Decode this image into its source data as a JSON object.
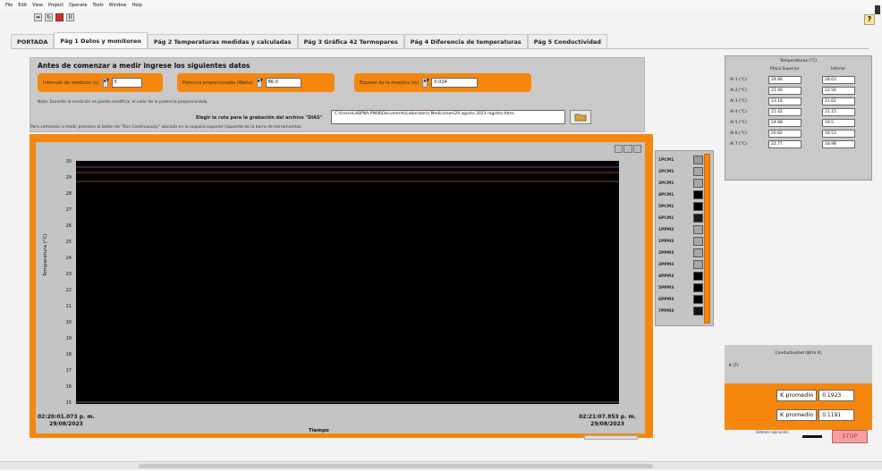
{
  "menu": [
    "File",
    "Edit",
    "View",
    "Project",
    "Operate",
    "Tools",
    "Window",
    "Help"
  ],
  "toolbar": {
    "run_glyph": "➡",
    "cont_glyph": "↻",
    "stop_glyph": "■",
    "pause_glyph": "II"
  },
  "help_glyph": "?",
  "tabs": [
    {
      "label": "PORTADA",
      "active": false
    },
    {
      "label": "Pág 1 Datos y monitoreo",
      "active": true
    },
    {
      "label": "Pág 2 Temperaturas medidas y calculadas",
      "active": false
    },
    {
      "label": "Pág 3 Gráfica 42 Termopares",
      "active": false
    },
    {
      "label": "Pág 4 Diferencia de temperaturas",
      "active": false
    },
    {
      "label": "Pág 5 Conductividad",
      "active": false
    }
  ],
  "setup": {
    "title": "Antes de comenzar a medir ingrese los siguientes datos",
    "field1": {
      "label": "Intervalo de medición (s)",
      "value": "5"
    },
    "field2": {
      "label": "Potencia proporcionada (Watts)",
      "value": "86.0"
    },
    "field3": {
      "label": "Espesor de la muestra (m)",
      "value": "0.024"
    },
    "note": "Nota: Durante la medición se puede modificar el valor de la potencia proporcionada.",
    "path_label": "Elegir la ruta para la grabación del archivo \"DIAS\"",
    "path_value": "C:\\Users\\LABPNA-PN08\\Documents\\Laboratorio Mediciones\\29 agosto 2023 registro.tdms",
    "instructions": "Para comenzar a medir presione el botón de \"Run Continuously\" ubicado en la esquina superior izquierda de la barra de herramientas."
  },
  "graph": {
    "y_title": "Temperatura (°C)",
    "y_ticks": [
      "30",
      "29",
      "28",
      "27",
      "26",
      "25",
      "24",
      "23",
      "22",
      "21",
      "20",
      "19",
      "18",
      "17",
      "16",
      "15"
    ],
    "x_start_time": "02:20:01.073 p. m.",
    "x_start_date": "29/08/2023",
    "x_end_time": "02:21:07.853 p. m.",
    "x_end_date": "29/08/2023",
    "x_title": "Tiempo"
  },
  "legend": [
    {
      "name": "1PCM1",
      "color": "#9a9a9a"
    },
    {
      "name": "2PCM1",
      "color": "#a7a7a7"
    },
    {
      "name": "3PCM1",
      "color": "#a7a7a7"
    },
    {
      "name": "4PCM1",
      "color": "#000000"
    },
    {
      "name": "5PCM1",
      "color": "#000000"
    },
    {
      "name": "6PCM1",
      "color": "#1a1a1a"
    },
    {
      "name": "1PPM2",
      "color": "#a7a7a7"
    },
    {
      "name": "1PPM3",
      "color": "#a7a7a7"
    },
    {
      "name": "2PPM3",
      "color": "#a7a7a7"
    },
    {
      "name": "3PPM3",
      "color": "#a7a7a7"
    },
    {
      "name": "4PPM3",
      "color": "#000000"
    },
    {
      "name": "5PPM3",
      "color": "#000000"
    },
    {
      "name": "6PPM3",
      "color": "#000000"
    },
    {
      "name": "7PPM3",
      "color": "#111111"
    }
  ],
  "temps": {
    "title": "Temperaturas (°C)",
    "col1": "Placa Superior",
    "col2": "Inferior",
    "rows": [
      {
        "name": "Al 1 (°C)",
        "v1": "24.86",
        "v2": "28.03"
      },
      {
        "name": "Al 2 (°C)",
        "v1": "21.46",
        "v2": "22.56"
      },
      {
        "name": "Al 3 (°C)",
        "v1": "23.16",
        "v2": "21.62"
      },
      {
        "name": "Al 4 (°C)",
        "v1": "21.42",
        "v2": "21.15"
      },
      {
        "name": "Al 5 (°C)",
        "v1": "24.98",
        "v2": "19.5"
      },
      {
        "name": "Al 6 (°C)",
        "v1": "20.82",
        "v2": "18.53"
      },
      {
        "name": "Al 7 (°C)",
        "v1": "22.77",
        "v2": "18.98"
      }
    ]
  },
  "conductivity": {
    "title": "Conductividad (W/m K)",
    "sub": "K (T)",
    "k1_label": "K promedio",
    "k1_value": "0.1923",
    "k2_label": "K promedio",
    "k2_value": "0.1191"
  },
  "stop": {
    "label": "Detener ejecución",
    "button": "STOP"
  }
}
